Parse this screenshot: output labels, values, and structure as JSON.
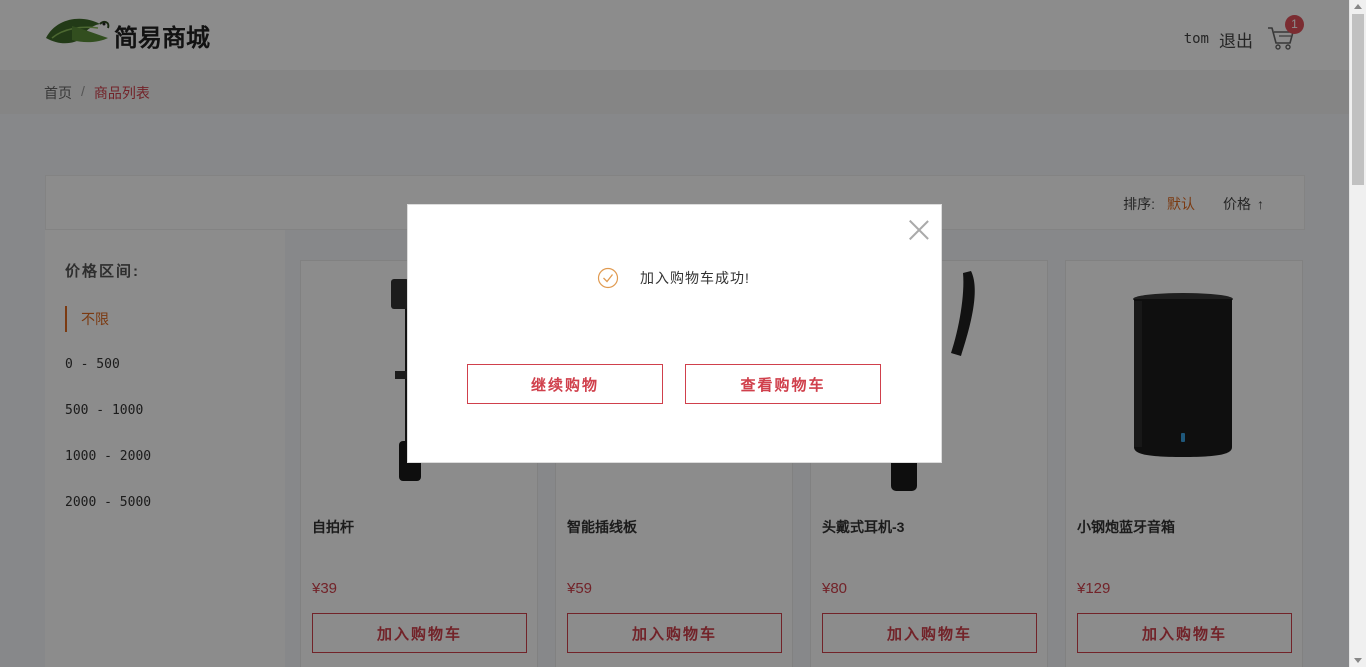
{
  "header": {
    "logo_text": "简易商城",
    "username": "tom",
    "logout_label": "退出",
    "cart_count": "1"
  },
  "breadcrumb": {
    "home": "首页",
    "separator": "/",
    "current": "商品列表"
  },
  "sort": {
    "label": "排序:",
    "default": "默认",
    "price": "价格",
    "arrow": "↑"
  },
  "filter": {
    "title": "价格区间:",
    "items": [
      "不限",
      "0 - 500",
      "500 - 1000",
      "1000 - 2000",
      "2000 - 5000"
    ],
    "active_index": 0
  },
  "products": [
    {
      "name": "自拍杆",
      "price": "¥39",
      "button": "加入购物车",
      "image": "selfie-stick"
    },
    {
      "name": "智能插线板",
      "price": "¥59",
      "button": "加入购物车",
      "image": "power-strip"
    },
    {
      "name": "头戴式耳机-3",
      "price": "¥80",
      "button": "加入购物车",
      "image": "headphones"
    },
    {
      "name": "小钢炮蓝牙音箱",
      "price": "¥129",
      "button": "加入购物车",
      "image": "bluetooth-speaker"
    }
  ],
  "dialog": {
    "message": "加入购物车成功!",
    "continue_label": "继续购物",
    "view_cart_label": "查看购物车",
    "icon": "check-circle-icon",
    "close_icon": "close-icon"
  },
  "colors": {
    "accent": "#d0404c",
    "active": "#e06a20",
    "overlay": "rgba(0,0,0,0.45)"
  }
}
